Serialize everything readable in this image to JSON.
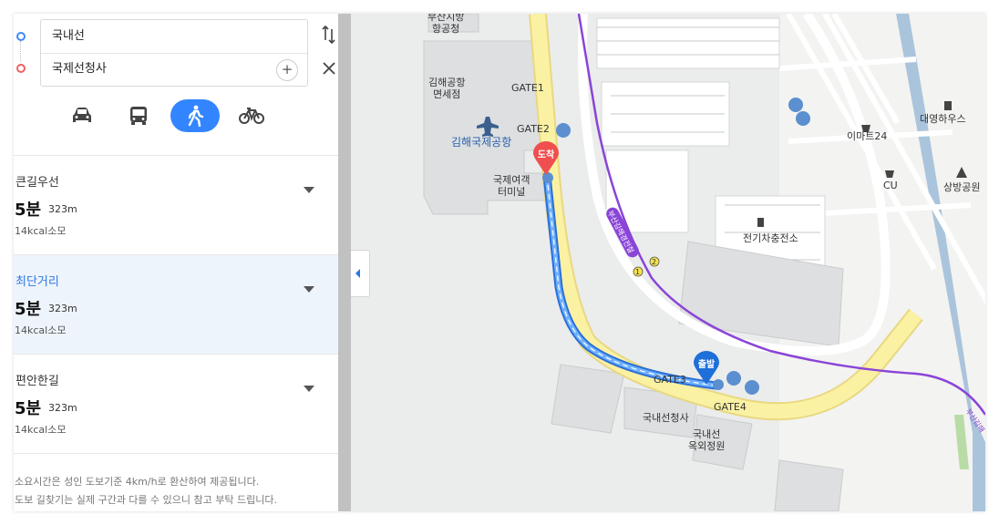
{
  "route": {
    "origin": "국내선",
    "destination": "국제선청사"
  },
  "icons": {
    "swap": "swap-icon",
    "add": "plus-icon",
    "close": "close-icon"
  },
  "modes": [
    {
      "name": "car",
      "icon": "car-icon",
      "active": false
    },
    {
      "name": "bus",
      "icon": "bus-icon",
      "active": false
    },
    {
      "name": "walk",
      "icon": "walk-icon",
      "active": true
    },
    {
      "name": "bike",
      "icon": "bike-icon",
      "active": false
    }
  ],
  "options": [
    {
      "name": "큰길우선",
      "time": "5분",
      "distance": "323m",
      "kcal": "14kcal소모",
      "selected": false
    },
    {
      "name": "최단거리",
      "time": "5분",
      "distance": "323m",
      "kcal": "14kcal소모",
      "selected": true
    },
    {
      "name": "편안한길",
      "time": "5분",
      "distance": "323m",
      "kcal": "14kcal소모",
      "selected": false
    }
  ],
  "notes": {
    "line1": "소요시간은 성인 도보기준 4km/h로 환산하여 제공됩니다.",
    "line2": "도보 길찾기는 실제 구간과 다를 수 있으니 참고 부탁 드립니다."
  },
  "map": {
    "labels": {
      "top_partial": "부산지방\n항공청",
      "dutyfree": "김해공항\n면세점",
      "gate1": "GATE1",
      "gate2": "GATE2",
      "airport": "김해국제공항",
      "intl_terminal": "국제여객\n터미널",
      "ev_station": "전기차충전소",
      "emart": "이마트24",
      "daeyoung": "대영하우스",
      "cu": "CU",
      "sangbang": "상방공원",
      "gate3": "GATE3",
      "gate4": "GATE4",
      "domestic": "국내선청사",
      "garden": "국내선\n옥외정원",
      "line_label": "부산김해경전철",
      "line_label2": "부산김해",
      "station_1": "1",
      "station_2": "2"
    },
    "markers": {
      "arrival": "도착",
      "departure": "출발"
    },
    "colors": {
      "route": "#3d8af7",
      "rail": "#8a44d8",
      "road": "#fbf1a3",
      "arrival_pin": "#f04f4f",
      "departure_pin": "#1e6fd9"
    }
  }
}
